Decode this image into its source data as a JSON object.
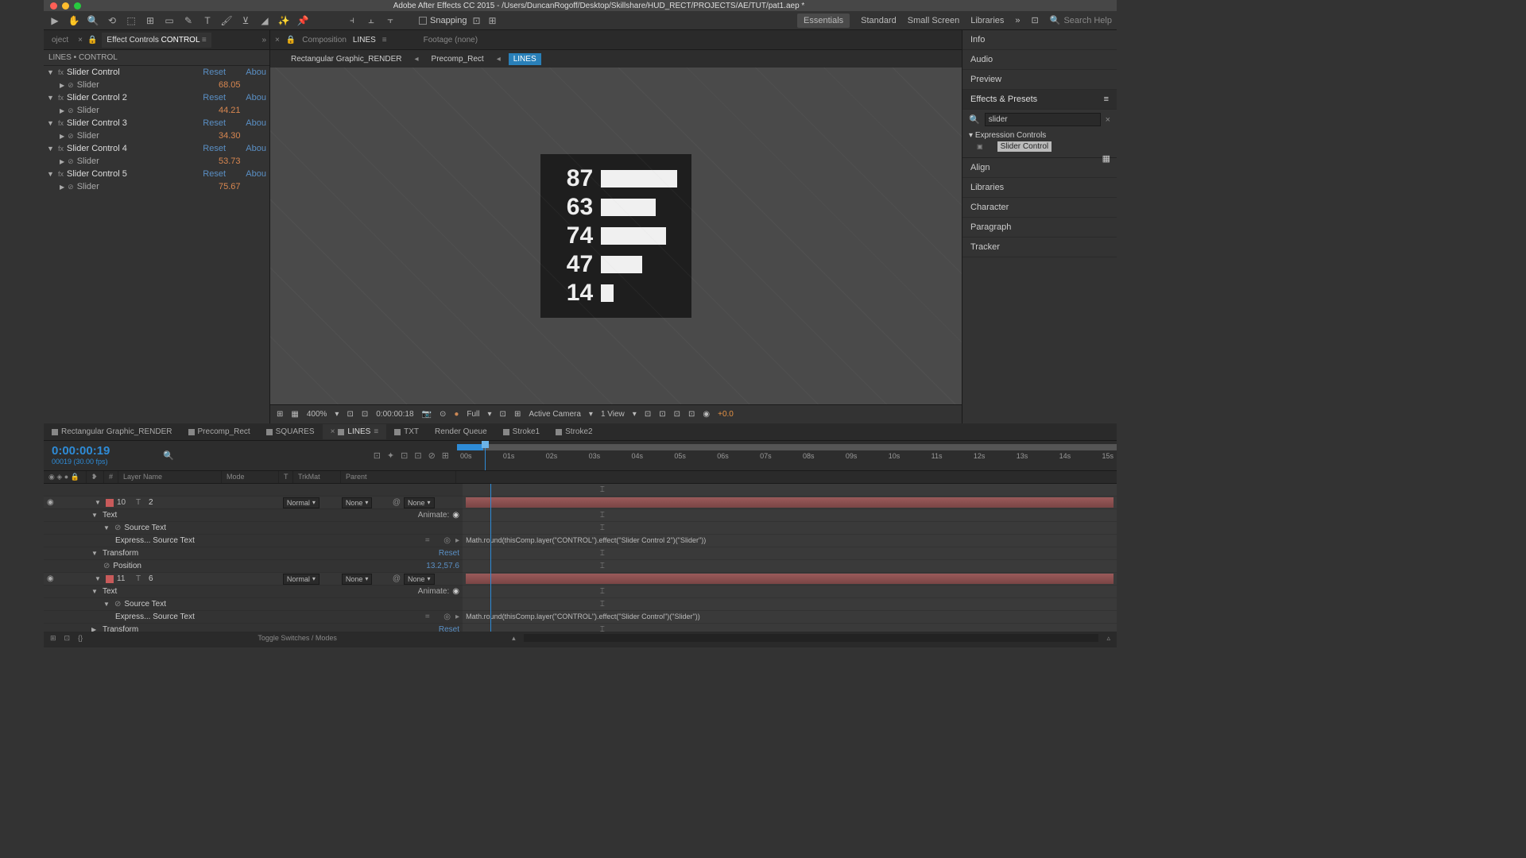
{
  "titlebar": "Adobe After Effects CC 2015 - /Users/DuncanRogoff/Desktop/Skillshare/HUD_RECT/PROJECTS/AE/TUT/pat1.aep *",
  "snapping": "Snapping",
  "workspaces": {
    "essentials": "Essentials",
    "standard": "Standard",
    "small": "Small Screen",
    "libraries": "Libraries"
  },
  "search_help_placeholder": "Search Help",
  "left": {
    "tab_project": "oject",
    "tab_effect": "Effect Controls",
    "tab_effect_layer": "CONTROL",
    "header": "LINES • CONTROL",
    "effects": [
      {
        "name": "Slider Control",
        "reset": "Reset",
        "about": "Abou",
        "slider": "Slider",
        "val": "68.05"
      },
      {
        "name": "Slider Control 2",
        "reset": "Reset",
        "about": "Abou",
        "slider": "Slider",
        "val": "44.21"
      },
      {
        "name": "Slider Control 3",
        "reset": "Reset",
        "about": "Abou",
        "slider": "Slider",
        "val": "34.30"
      },
      {
        "name": "Slider Control 4",
        "reset": "Reset",
        "about": "Abou",
        "slider": "Slider",
        "val": "53.73"
      },
      {
        "name": "Slider Control 5",
        "reset": "Reset",
        "about": "Abou",
        "slider": "Slider",
        "val": "75.67"
      }
    ]
  },
  "center": {
    "comp_label": "Composition",
    "comp_name": "LINES",
    "footage": "Footage (none)",
    "crumbs": [
      "Rectangular Graphic_RENDER",
      "Precomp_Rect",
      "LINES"
    ],
    "footer": {
      "zoom": "400%",
      "timecode": "0:00:00:18",
      "res": "Full",
      "camera": "Active Camera",
      "view": "1 View",
      "offset": "+0.0"
    }
  },
  "chart_data": {
    "type": "bar",
    "categories": [
      "87",
      "63",
      "74",
      "47",
      "14"
    ],
    "values": [
      87,
      63,
      74,
      47,
      14
    ],
    "orientation": "horizontal",
    "max": 100
  },
  "right": {
    "panels": [
      "Info",
      "Audio",
      "Preview"
    ],
    "ep": "Effects & Presets",
    "search": "slider",
    "tree_head": "Expression Controls",
    "tree_leaf": "Slider Control",
    "panels2": [
      "Align",
      "Libraries",
      "Character",
      "Paragraph",
      "Tracker"
    ]
  },
  "timeline": {
    "tabs": [
      "Rectangular Graphic_RENDER",
      "Precomp_Rect",
      "SQUARES",
      "LINES",
      "TXT",
      "Render Queue",
      "Stroke1",
      "Stroke2"
    ],
    "active_tab": "LINES",
    "timecode": "0:00:00:19",
    "frames": "00019 (30.00 fps)",
    "ruler": [
      "00s",
      "01s",
      "02s",
      "03s",
      "04s",
      "05s",
      "06s",
      "07s",
      "08s",
      "09s",
      "10s",
      "11s",
      "12s",
      "13s",
      "14s",
      "15s"
    ],
    "cols": {
      "idx": "#",
      "layer": "Layer Name",
      "mode": "Mode",
      "t": "T",
      "trkmat": "TrkMat",
      "parent": "Parent"
    },
    "layers": [
      {
        "num": "10",
        "name": "2",
        "mode": "Normal",
        "trkmat": "None",
        "parent": "None",
        "text": "Text",
        "animate": "Animate:",
        "src": "Source Text",
        "expr": "Express... Source Text",
        "transform": "Transform",
        "reset": "Reset",
        "pos": "Position",
        "posval": "13.2,57.6",
        "expression": "Math.round(thisComp.layer(\"CONTROL\").effect(\"Slider Control 2\")(\"Slider\"))"
      },
      {
        "num": "11",
        "name": "6",
        "mode": "Normal",
        "trkmat": "None",
        "parent": "None",
        "text": "Text",
        "animate": "Animate:",
        "src": "Source Text",
        "expr": "Express... Source Text",
        "transform": "Transform",
        "reset": "Reset",
        "expression": "Math.round(thisComp.layer(\"CONTROL\").effect(\"Slider Control\")(\"Slider\"))"
      }
    ],
    "footer": "Toggle Switches / Modes"
  }
}
